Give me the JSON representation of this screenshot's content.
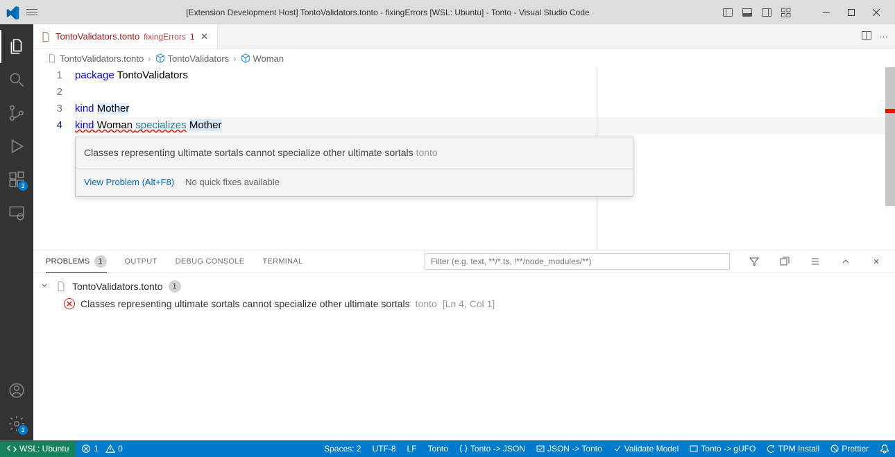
{
  "title": "[Extension Development Host] TontoValidators.tonto - fixingErrors [WSL: Ubuntu] - Tonto - Visual Studio Code",
  "activitybar": {
    "items": [
      "explorer",
      "search",
      "scm",
      "debug",
      "extensions",
      "remote"
    ],
    "ext_badge": "1",
    "manage_badge": "1"
  },
  "tab": {
    "filename": "TontoValidators.tonto",
    "folder": "fixingErrors",
    "errorCount": "1"
  },
  "breadcrumbs": {
    "file": "TontoValidators.tonto",
    "pkg": "TontoValidators",
    "symbol": "Woman"
  },
  "code": {
    "lines": {
      "l1_kw": "package",
      "l1_rest": " TontoValidators",
      "l3_kw": "kind",
      "l3_rest": " Mother",
      "l4_kw": "kind",
      "l4_a": " Woman ",
      "l4_spec": "specializes",
      "l4_b": " Mother"
    }
  },
  "hover": {
    "message": "Classes representing ultimate sortals cannot specialize other ultimate sortals ",
    "source": "tonto",
    "viewProblem": "View Problem (Alt+F8)",
    "noFix": "No quick fixes available"
  },
  "panel": {
    "tabs": {
      "problems": "PROBLEMS",
      "output": "OUTPUT",
      "debug": "DEBUG CONSOLE",
      "terminal": "TERMINAL"
    },
    "problemsCount": "1",
    "filterPlaceholder": "Filter (e.g. text, **/*.ts, !**/node_modules/**)",
    "file": "TontoValidators.tonto",
    "fileCount": "1",
    "message": "Classes representing ultimate sortals cannot specialize other ultimate sortals",
    "source": "tonto",
    "location": "[Ln 4, Col 1]"
  },
  "statusbar": {
    "remote": "WSL: Ubuntu",
    "errors": "1",
    "warnings": "0",
    "spaces": "Spaces: 2",
    "encoding": "UTF-8",
    "eol": "LF",
    "lang": "Tonto",
    "tjson": "Tonto -> JSON",
    "jtonto": "JSON -> Tonto",
    "validate": "Validate Model",
    "gufo": "Tonto -> gUFO",
    "tpm": "TPM Install",
    "prettier": "Prettier"
  }
}
